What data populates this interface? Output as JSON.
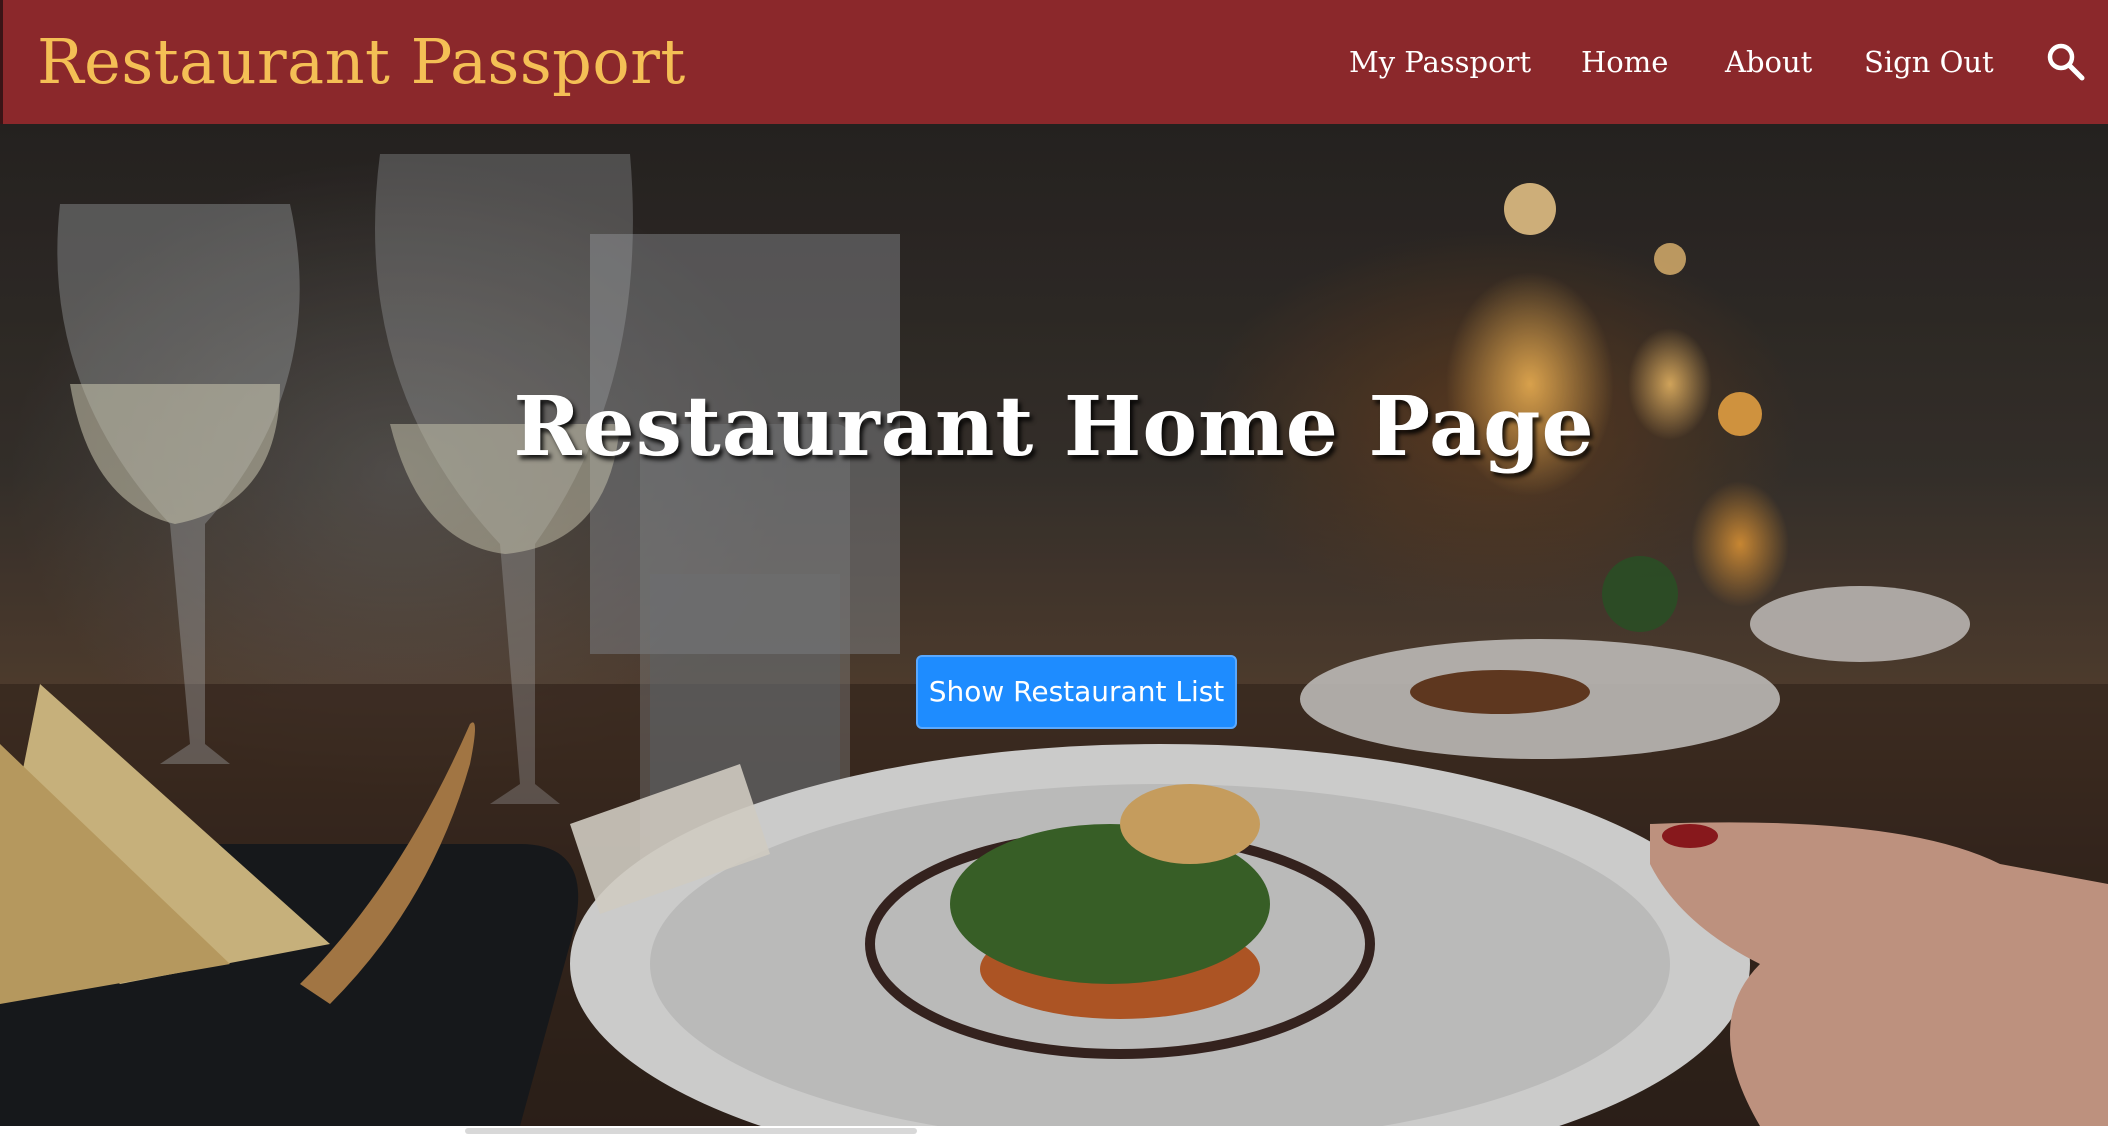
{
  "navbar": {
    "brand": "Restaurant Passport",
    "links": {
      "my_passport": "My Passport",
      "home": "Home",
      "about": "About",
      "sign_out": "Sign Out"
    },
    "search_icon": "search-icon"
  },
  "hero": {
    "title": "Restaurant Home Page",
    "button_label": "Show Restaurant List",
    "background_image": "restaurant table with wine glasses, bread basket and plated dish"
  },
  "colors": {
    "navbar_bg": "#8b282b",
    "brand_text": "#f4bf55",
    "nav_text": "#ffffff",
    "button_bg": "#1e8cff"
  }
}
